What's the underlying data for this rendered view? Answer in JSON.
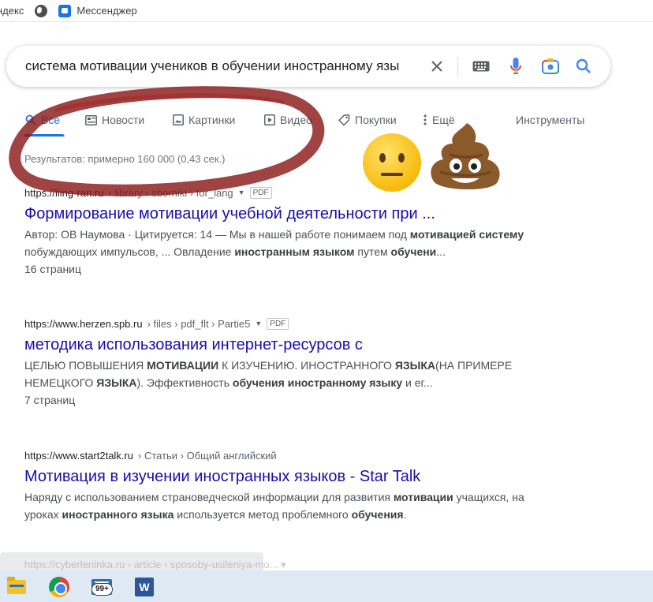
{
  "bookmarks": [
    {
      "label": "ндекс"
    },
    {
      "label": ""
    },
    {
      "label": "Мессенджер"
    }
  ],
  "search": {
    "query": "система мотивации учеников в обучении иностранному язы"
  },
  "tabs": [
    {
      "label": "Все",
      "icon": "search-icon",
      "active": true
    },
    {
      "label": "Новости",
      "icon": "news-icon"
    },
    {
      "label": "Картинки",
      "icon": "image-icon"
    },
    {
      "label": "Видео",
      "icon": "video-icon"
    },
    {
      "label": "Покупки",
      "icon": "tag-icon"
    },
    {
      "label": "Ещё",
      "icon": "more-dots-icon"
    },
    {
      "label": "Инструменты"
    }
  ],
  "stats": "Результатов: примерно 160 000 (0,43 сек.)",
  "results": [
    {
      "url": "https://iling-ran.ru",
      "path": "› library › sborniki › for_lang",
      "badge": "PDF",
      "title": "Формирование мотивации учебной деятельности при ...",
      "snippet_html": "Автор: ОВ Наумова · Цитируется: 14 — Мы в нашей работе понимаем под <b>мотивацией системy</b> побуждающих импульсов, ... Овладение <b>иностранным языком</b> путем <b>обучени</b>...",
      "meta": "16 страниц"
    },
    {
      "url": "https://www.herzen.spb.ru",
      "path": "› files › pdf_flt › Partie5",
      "badge": "PDF",
      "title": "методика использования интернет-ресурсов с",
      "snippet_html": "ЦЕЛЬЮ ПОВЫШЕНИЯ <b>МОТИВАЦИИ</b> К ИЗУЧЕНИЮ. ИНОСТРАННОГО <b>ЯЗЫКА</b>(НА ПРИМЕРЕ НЕМЕЦКОГО <b>ЯЗЫКА</b>). Эффективность <b>обучения иностранному языку</b> и ег...",
      "meta": "7 страниц"
    },
    {
      "url": "https://www.start2talk.ru",
      "path": "› Статьи › Общий английский",
      "badge": "",
      "title": "Мотивация в изучении иностранных языков - Star Talk",
      "snippet_html": "Наряду с использованием страноведческой информации для развития <b>мотивации</b> учащихся, на уроках <b>иностранного языка</b> используется метод проблемного <b>обучения</b>.",
      "meta": ""
    }
  ],
  "faded_result": {
    "cite": "https://cyberleninka.ru › article › sposoby-usileniya-mo... ▾"
  },
  "taskbar": {
    "mail_badge": "99+",
    "word_letter": "W"
  },
  "colors": {
    "link": "#1a0dab",
    "accent": "#1a73e8",
    "annotation": "#8b1a1a"
  }
}
